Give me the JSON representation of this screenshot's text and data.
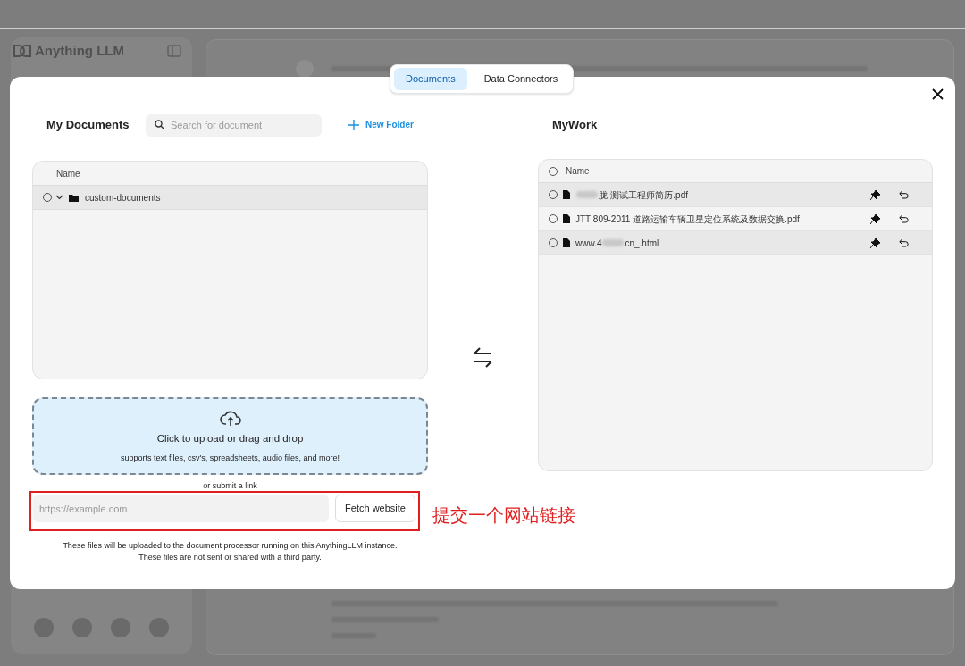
{
  "app": {
    "logo_text": "Anything LLM"
  },
  "tabs": [
    {
      "label": "Documents",
      "selected": true
    },
    {
      "label": "Data Connectors",
      "selected": false
    }
  ],
  "my_documents": {
    "title": "My Documents",
    "search": {
      "placeholder": "Search for document"
    },
    "new_folder": "New Folder",
    "column": "Name",
    "folders": [
      {
        "name": "custom-documents",
        "checked": false,
        "expanded": true
      }
    ]
  },
  "upload": {
    "title": "Click to upload or drag and drop",
    "subtitle": "supports text files, csv's, spreadsheets, audio files, and more!"
  },
  "link": {
    "label": "or submit a link",
    "placeholder": "https://example.com",
    "button": "Fetch website"
  },
  "annotation": "提交一个网站链接",
  "notice": [
    "These files will be uploaded to the document processor running on this AnythingLLM instance.",
    "These files are not sent or shared with a third party."
  ],
  "workspace": {
    "title": "MyWork",
    "column": "Name",
    "all_checked": false,
    "files": [
      {
        "name_parts": [
          "胧-测试工程师简历.pdf"
        ],
        "redacted": true,
        "checked": false,
        "highlighted": true
      },
      {
        "name_parts": [
          "JTT 809-2011 道路运输车辆卫星定位系统及数据交换.pdf"
        ],
        "redacted": false,
        "checked": false,
        "highlighted": false
      },
      {
        "name_parts": [
          "www.4",
          "cn_.html"
        ],
        "redacted": true,
        "checked": false,
        "highlighted": true
      }
    ]
  }
}
